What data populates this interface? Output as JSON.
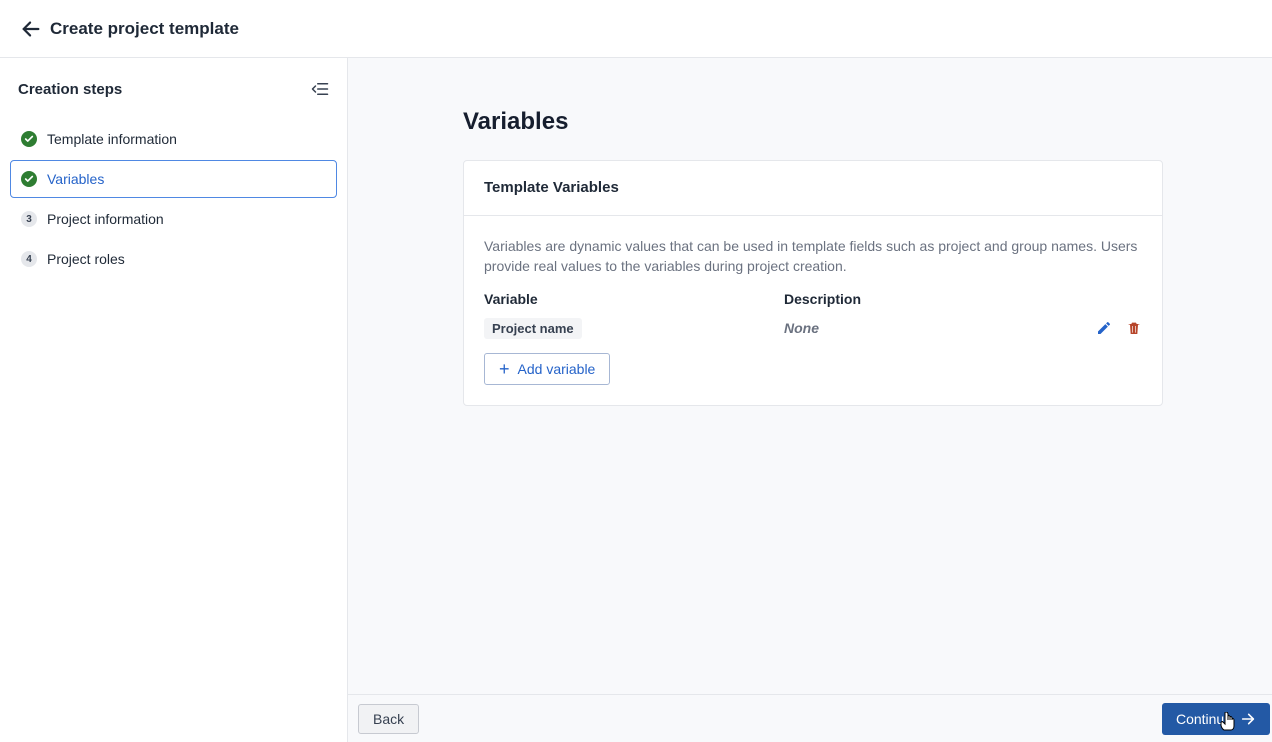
{
  "header": {
    "title": "Create project template"
  },
  "sidebar": {
    "title": "Creation steps",
    "steps": [
      {
        "label": "Template information",
        "status": "done"
      },
      {
        "label": "Variables",
        "status": "active"
      },
      {
        "num": "3",
        "label": "Project information",
        "status": "pending"
      },
      {
        "num": "4",
        "label": "Project roles",
        "status": "pending"
      }
    ]
  },
  "main": {
    "page_title": "Variables",
    "card": {
      "title": "Template Variables",
      "description": "Variables are dynamic values that can be used in template fields such as project and group names. Users provide real values to the variables during project creation.",
      "columns": {
        "variable": "Variable",
        "description": "Description"
      },
      "rows": [
        {
          "name": "Project name",
          "description": "None"
        }
      ],
      "add_button": "Add variable"
    }
  },
  "footer": {
    "back": "Back",
    "continue": "Continue"
  }
}
